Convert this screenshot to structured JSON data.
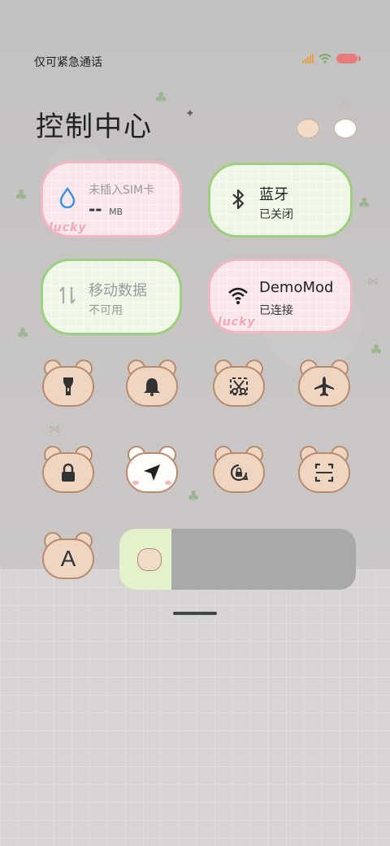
{
  "status_bar": {
    "carrier_text": "仅可紧急通话",
    "icons": [
      "signal-icon",
      "wifi-icon",
      "battery-icon"
    ]
  },
  "header": {
    "title": "控制中心"
  },
  "tiles": {
    "mobile_data_usage": {
      "line1": "未插入SIM卡",
      "value": "--",
      "unit": "MB",
      "icon": "water-drop-icon"
    },
    "bluetooth": {
      "label": "蓝牙",
      "status": "已关闭",
      "icon": "bluetooth-icon"
    },
    "mobile_data": {
      "label": "移动数据",
      "status": "不可用",
      "icon": "data-arrows-icon"
    },
    "wifi": {
      "label": "DemoMod",
      "status": "已连接",
      "icon": "wifi-icon"
    }
  },
  "decor": {
    "lucky_1": "lucky",
    "lucky_2": "lucky"
  },
  "toggles": [
    {
      "name": "flashlight",
      "icon": "flashlight-icon",
      "active": false
    },
    {
      "name": "bell",
      "icon": "bell-icon",
      "active": false
    },
    {
      "name": "screenshot",
      "icon": "scissors-icon",
      "active": false
    },
    {
      "name": "airplane",
      "icon": "airplane-icon",
      "active": false
    },
    {
      "name": "lock",
      "icon": "lock-icon",
      "active": false
    },
    {
      "name": "location",
      "icon": "location-arrow-icon",
      "active": true
    },
    {
      "name": "rotation-lock",
      "icon": "rotation-lock-icon",
      "active": false
    },
    {
      "name": "scanner",
      "icon": "scan-icon",
      "active": false
    },
    {
      "name": "font-size",
      "icon": "font-icon",
      "label": "A",
      "active": false
    }
  ],
  "brightness": {
    "level": 0.22,
    "icon": "brightness-icon"
  },
  "colors": {
    "pink_accent": "#f4b6c4",
    "green_accent": "#9ccf7e",
    "bear_fill": "#efd6c3",
    "bear_border": "#b88a6e",
    "slider_fill": "#e4f2cc"
  }
}
